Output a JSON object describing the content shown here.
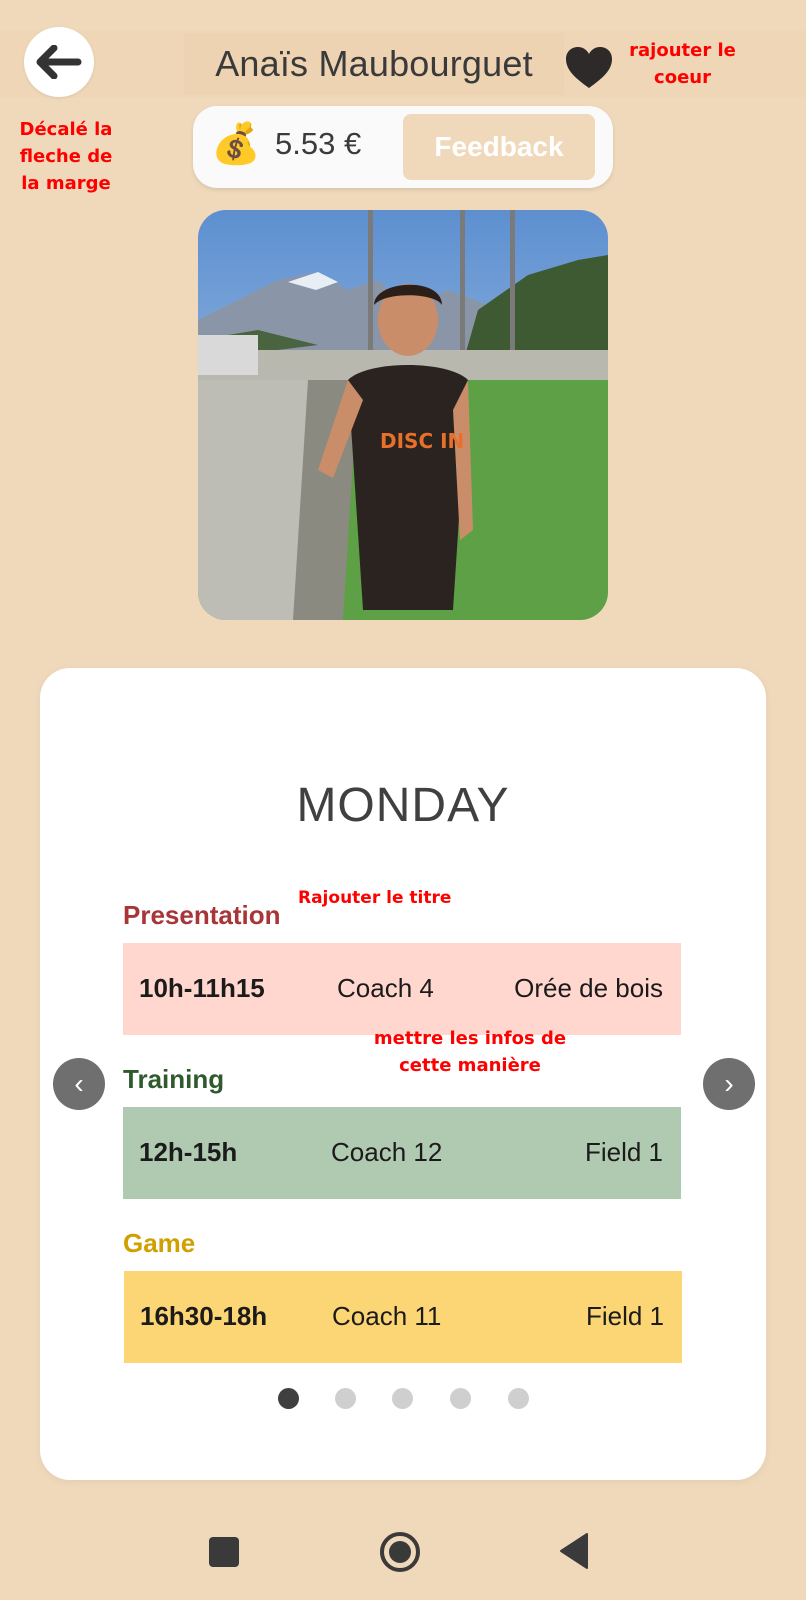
{
  "header": {
    "name": "Anaïs Maubourguet",
    "back_icon": "arrow-left-icon",
    "favorite_icon": "heart-icon"
  },
  "wallet": {
    "icon": "money-bag-icon",
    "bag_glyph": "💰",
    "amount": "5.53 €",
    "feedback_label": "Feedback"
  },
  "annotations": {
    "arrow_note": "Décalé la fleche de la marge",
    "heart_note": "rajouter le coeur",
    "title_note": "Rajouter le titre",
    "info_note": "mettre les infos de cette manière"
  },
  "schedule": {
    "day": "MONDAY",
    "prev_glyph": "‹",
    "next_glyph": "›",
    "sessions": [
      {
        "label": "Presentation",
        "time": "10h-11h15",
        "coach": "Coach 4",
        "place": "Orée de bois",
        "label_color": "#a83638",
        "bg_color": "#ffd7cf"
      },
      {
        "label": "Training",
        "time": "12h-15h",
        "coach": "Coach 12",
        "place": "Field 1",
        "label_color": "#2f5a2e",
        "bg_color": "#b0c9b1"
      },
      {
        "label": "Game",
        "time": "16h30-18h",
        "coach": "Coach 11",
        "place": "Field 1",
        "label_color": "#d1a000",
        "bg_color": "#fcd574"
      }
    ],
    "pagination": {
      "total": 5,
      "active": 1
    }
  },
  "system_nav": {
    "recent_icon": "square-icon",
    "home_icon": "circle-home-icon",
    "back_icon": "triangle-back-icon"
  },
  "colors": {
    "background": "#f0d9bb",
    "card": "#ffffff",
    "annotation": "#ff0000"
  }
}
